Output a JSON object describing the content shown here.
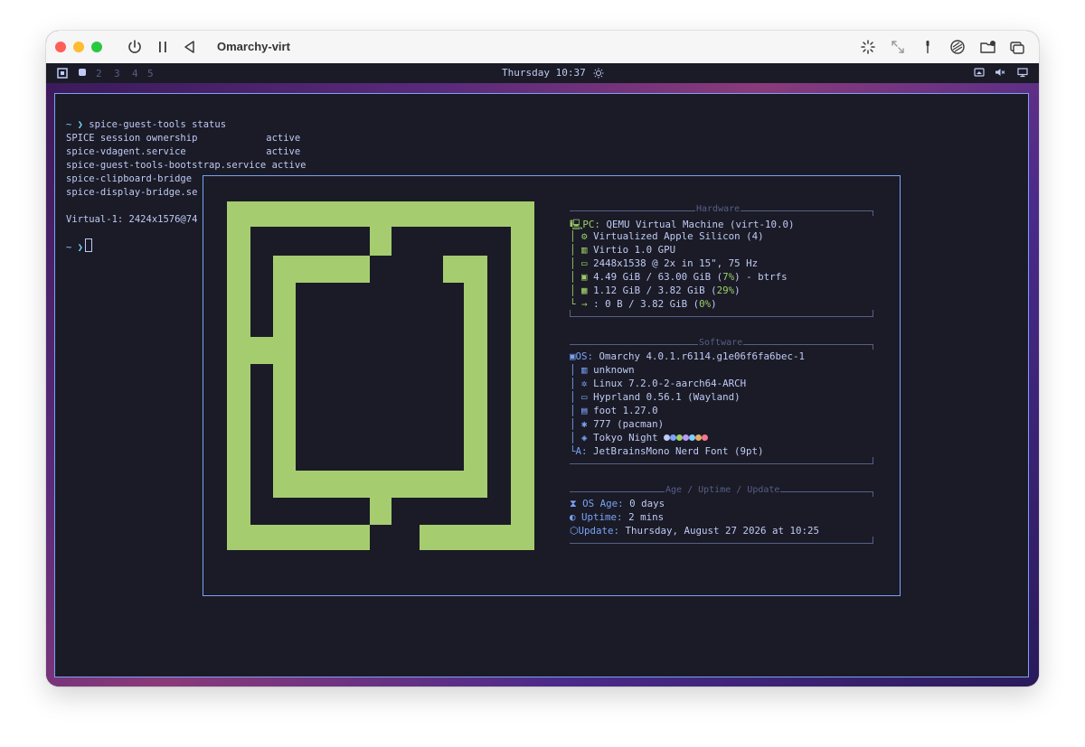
{
  "window": {
    "title": "Omarchy-virt"
  },
  "topbar": {
    "workspaces": [
      "2",
      "3",
      "4",
      "5"
    ],
    "clock": "Thursday 10:37"
  },
  "terminal": {
    "prompt_symbol": "~ ❯",
    "command": "spice-guest-tools status",
    "lines": [
      "SPICE session ownership            active",
      "spice-vdagent.service              active",
      "spice-guest-tools-bootstrap.service active",
      "spice-clipboard-bridge",
      "spice-display-bridge.se",
      "",
      "Virtual-1: 2424x1576@74"
    ]
  },
  "fastfetch": {
    "hardware": {
      "title": "Hardware",
      "rows": [
        {
          "key": "PC:",
          "value": "QEMU Virtual Machine (virt-10.0)"
        },
        {
          "key": "",
          "value": "Virtualized Apple Silicon (4)"
        },
        {
          "key": "",
          "value": "Virtio 1.0 GPU"
        },
        {
          "key": "",
          "value": "2448x1538 @ 2x in 15\", 75 Hz"
        },
        {
          "key": "",
          "value_pre": "4.49 GiB / 63.00 GiB (",
          "pct": "7%",
          "value_post": ") - btrfs"
        },
        {
          "key": "",
          "value_pre": "1.12 GiB / 3.82 GiB (",
          "pct": "29%",
          "value_post": ")"
        },
        {
          "key": "",
          "value_pre": ": 0 B / 3.82 GiB (",
          "pct": "0%",
          "value_post": ")"
        }
      ]
    },
    "software": {
      "title": "Software",
      "rows": [
        {
          "key": "OS:",
          "value": "Omarchy 4.0.1.r6114.g1e06f6fa6bec-1"
        },
        {
          "key": "",
          "value": "unknown"
        },
        {
          "key": "",
          "value": "Linux 7.2.0-2-aarch64-ARCH"
        },
        {
          "key": "",
          "value": "Hyprland 0.56.1 (Wayland)"
        },
        {
          "key": "",
          "value": "foot 1.27.0"
        },
        {
          "key": "",
          "value": "777 (pacman)"
        },
        {
          "key": "",
          "value": "Tokyo Night"
        },
        {
          "key": "A:",
          "value": "JetBrainsMono Nerd Font (9pt)"
        }
      ],
      "palette": [
        "#c0caf5",
        "#7aa2f7",
        "#9ece6a",
        "#bb9af7",
        "#7dcfff",
        "#e0af68",
        "#f7768e"
      ]
    },
    "age": {
      "title": "Age / Uptime / Update",
      "rows": [
        {
          "key": "OS Age:",
          "value": "0 days"
        },
        {
          "key": "Uptime:",
          "value": "2 mins"
        },
        {
          "key": "Update:",
          "value": "Thursday, August 27 2026 at 10:25"
        }
      ]
    }
  },
  "colors": {
    "logo_green": "#a6cc70",
    "terminal_bg": "#1a1b26",
    "border_blue": "#7aa2f7",
    "text": "#c0caf5"
  }
}
